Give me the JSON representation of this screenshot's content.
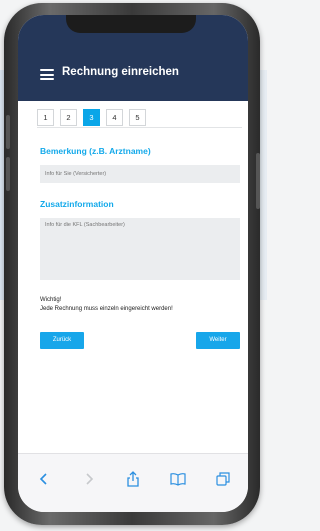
{
  "header": {
    "title": "Rechnung einreichen",
    "menu_icon": "menu-icon"
  },
  "steps": [
    {
      "label": "1",
      "active": false
    },
    {
      "label": "2",
      "active": false
    },
    {
      "label": "3",
      "active": true
    },
    {
      "label": "4",
      "active": false
    },
    {
      "label": "5",
      "active": false
    }
  ],
  "form": {
    "remark": {
      "label": "Bemerkung (z.B. Arztname)",
      "placeholder": "Info für Sie (Versicherter)",
      "value": ""
    },
    "additional": {
      "label": "Zusatzinformation",
      "placeholder": "Info für die KFL (Sachbearbeiter)",
      "value": ""
    },
    "notice_title": "Wichtig!",
    "notice_text": "Jede Rechnung muss einzeln eingereicht werden!"
  },
  "buttons": {
    "back": "Zurück",
    "next": "Weiter"
  },
  "browser_toolbar": {
    "icons": [
      "back-arrow-icon",
      "forward-arrow-icon",
      "share-icon",
      "bookmarks-icon",
      "tabs-icon"
    ]
  },
  "colors": {
    "header": "#253759",
    "accent": "#13a9ea"
  }
}
